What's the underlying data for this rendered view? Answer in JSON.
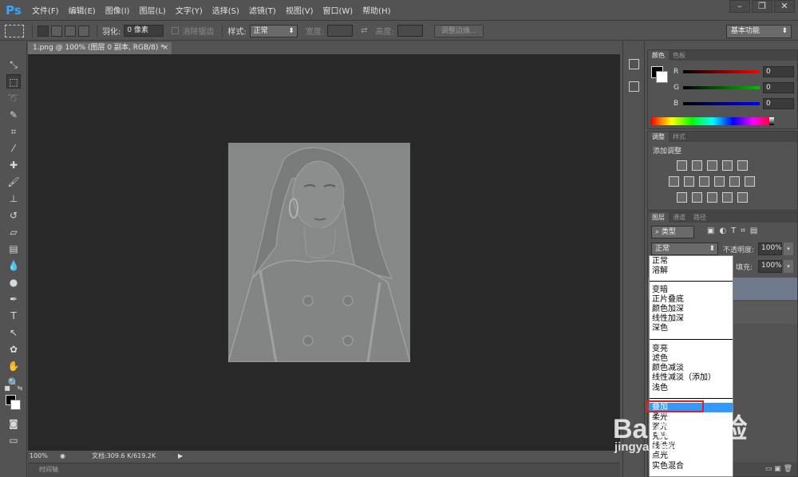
{
  "app": {
    "logo": "Ps"
  },
  "menu": [
    "文件(F)",
    "编辑(E)",
    "图像(I)",
    "图层(L)",
    "文字(Y)",
    "选择(S)",
    "滤镜(T)",
    "视图(V)",
    "窗口(W)",
    "帮助(H)"
  ],
  "options": {
    "feather_label": "羽化:",
    "feather_value": "0 像素",
    "antialias_label": "消除锯齿",
    "style_label": "样式:",
    "style_value": "正常",
    "width_label": "宽度:",
    "height_label": "高度:",
    "refine_edge": "调整边缘...",
    "workspace": "基本功能"
  },
  "document": {
    "tab_title": "1.png @ 100% (图层 0 副本, RGB/8) *",
    "zoom": "100%",
    "doc_info": "文档:309.6 K/619.2K",
    "timeline_label": "时间轴"
  },
  "color_panel": {
    "tabs": [
      "颜色",
      "色板"
    ],
    "channels": [
      {
        "label": "R",
        "value": "0",
        "color": "#ff0000"
      },
      {
        "label": "G",
        "value": "0",
        "color": "#00c000"
      },
      {
        "label": "B",
        "value": "0",
        "color": "#0000ff"
      }
    ]
  },
  "adjust_panel": {
    "tabs": [
      "调整",
      "样式"
    ],
    "title": "添加调整"
  },
  "layers_panel": {
    "tabs": [
      "图层",
      "通道",
      "路径"
    ],
    "filter_kind": "类型",
    "blend_mode": "正常",
    "opacity_label": "不透明度:",
    "opacity_value": "100%",
    "fill_label": "填充:",
    "fill_value": "100%"
  },
  "blend_menu": {
    "groups": [
      [
        "正常",
        "溶解"
      ],
      [
        "变暗",
        "正片叠底",
        "颜色加深",
        "线性加深",
        "深色"
      ],
      [
        "变亮",
        "滤色",
        "颜色减淡",
        "线性减淡（添加）",
        "浅色"
      ],
      [
        "叠加",
        "柔光",
        "强光",
        "亮光",
        "线性光",
        "点光",
        "实色混合"
      ]
    ],
    "selected": "叠加"
  },
  "watermark": {
    "brand": "Baidu",
    "brand_cn": "经验",
    "url": "jingyan.baidu.com"
  }
}
